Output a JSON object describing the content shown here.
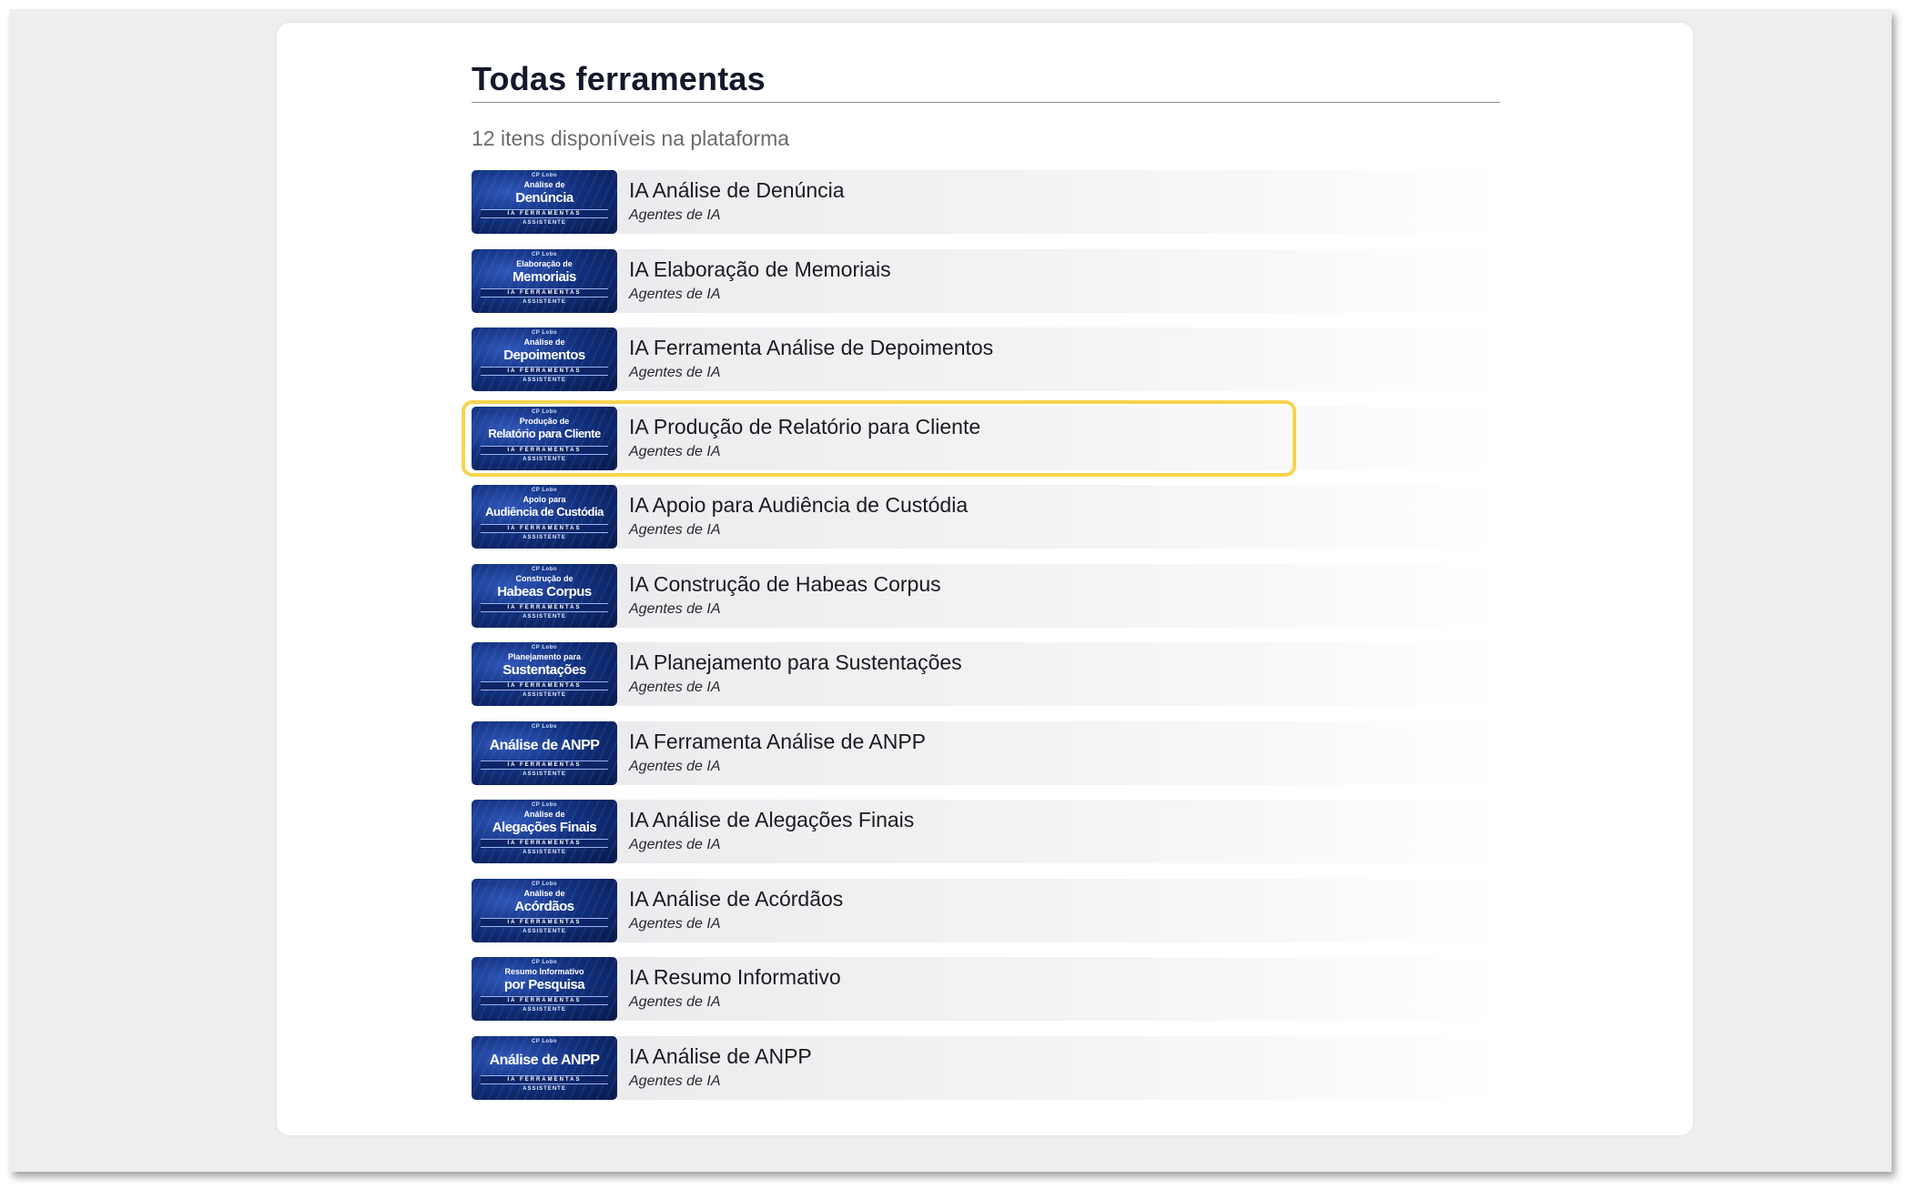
{
  "page": {
    "title": "Todas ferramentas",
    "subtitle": "12 itens disponíveis na plataforma"
  },
  "tools": [
    {
      "name": "IA Análise de Denúncia",
      "category": "Agentes de IA",
      "thumb_small": "Análise de",
      "thumb_big": "Denúncia"
    },
    {
      "name": "IA Elaboração de Memoriais",
      "category": "Agentes de IA",
      "thumb_small": "Elaboração de",
      "thumb_big": "Memoriais"
    },
    {
      "name": "IA Ferramenta Análise de Depoimentos",
      "category": "Agentes de IA",
      "thumb_small": "Análise de",
      "thumb_big": "Depoimentos"
    },
    {
      "name": "IA Produção de Relatório para Cliente",
      "category": "Agentes de IA",
      "thumb_small": "Produção de",
      "thumb_big": "Relatório para Cliente",
      "highlighted": true
    },
    {
      "name": "IA Apoio para Audiência de Custódia",
      "category": "Agentes de IA",
      "thumb_small": "Apoio para",
      "thumb_big": "Audiência de Custódia"
    },
    {
      "name": "IA Construção de Habeas Corpus",
      "category": "Agentes de IA",
      "thumb_small": "Construção de",
      "thumb_big": "Habeas Corpus"
    },
    {
      "name": "IA Planejamento para Sustentações",
      "category": "Agentes de IA",
      "thumb_small": "Planejamento para",
      "thumb_big": "Sustentações"
    },
    {
      "name": "IA Ferramenta Análise de ANPP",
      "category": "Agentes de IA",
      "thumb_small": "",
      "thumb_big": "Análise de ANPP"
    },
    {
      "name": "IA Análise de Alegações Finais",
      "category": "Agentes de IA",
      "thumb_small": "Análise de",
      "thumb_big": "Alegações Finais"
    },
    {
      "name": "IA Análise de Acórdãos",
      "category": "Agentes de IA",
      "thumb_small": "Análise de",
      "thumb_big": "Acórdãos"
    },
    {
      "name": "IA Resumo Informativo",
      "category": "Agentes de IA",
      "thumb_small": "Resumo Informativo",
      "thumb_big": "por Pesquisa"
    },
    {
      "name": "IA Análise de ANPP",
      "category": "Agentes de IA",
      "thumb_small": "",
      "thumb_big": "Análise de ANPP"
    }
  ],
  "thumbnail": {
    "brand": "CP Lobo",
    "band_text": "IA FERRAMENTAS",
    "tag": "ASSISTENTE"
  },
  "colors": {
    "highlight": "#f7d44e",
    "thumbnail_blue": "#12307d"
  }
}
